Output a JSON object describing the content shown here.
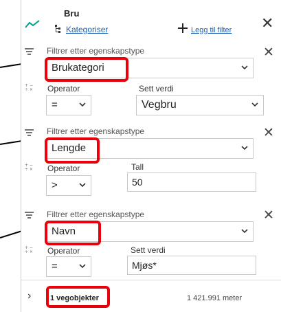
{
  "header": {
    "title": "Bru",
    "categorize_link": "Kategoriser",
    "add_filter_link": "Legg til filter",
    "close": "✕",
    "icons": [
      "trend-icon",
      "categorize-icon",
      "plus-icon",
      "close-icon"
    ]
  },
  "filters": [
    {
      "label": "Filtrer etter egenskapstype",
      "property": "Brukategori",
      "operator_label": "Operator",
      "operator": "=",
      "value_label": "Sett verdi",
      "value": "Vegbru",
      "value_is_select": true
    },
    {
      "label": "Filtrer etter egenskapstype",
      "property": "Lengde",
      "operator_label": "Operator",
      "operator": ">",
      "value_label": "Tall",
      "value": "50",
      "value_is_select": false
    },
    {
      "label": "Filtrer etter egenskapstype",
      "property": "Navn",
      "operator_label": "Operator",
      "operator": "=",
      "value_label": "Sett verdi",
      "value": "Mjøs*",
      "value_is_select": false
    }
  ],
  "footer": {
    "count": "1 vegobjekter",
    "length": "1 421.991 meter",
    "expand": "›"
  },
  "colors": {
    "highlight": "#e8000b",
    "link": "#1a5fb4",
    "accent": "#009c8f"
  }
}
